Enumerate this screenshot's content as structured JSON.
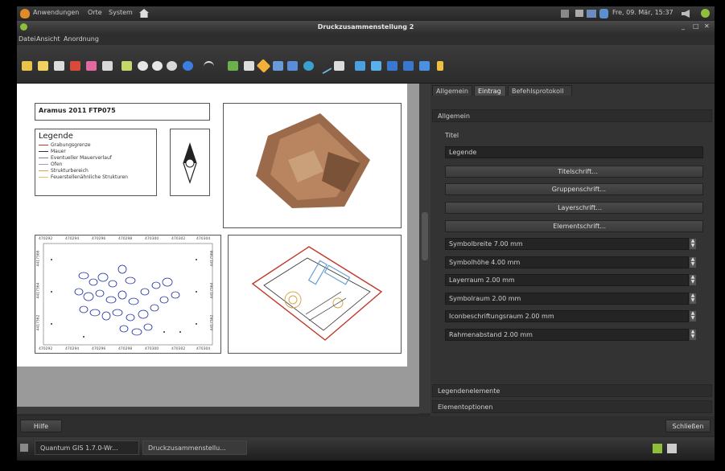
{
  "topbar": {
    "menus": [
      "Anwendungen",
      "Orte",
      "System"
    ],
    "clock": "Fre, 09. Mär, 15:37"
  },
  "window": {
    "title": "Druckzusammenstellung 2",
    "controls": [
      "_",
      "□",
      "✕"
    ]
  },
  "menubar": [
    "Datei",
    "Ansicht",
    "Anordnung"
  ],
  "composition": {
    "title_label": "Aramus 2011 FTP075",
    "legend_title": "Legende",
    "legend_items": [
      {
        "label": "Grabungsgrenze",
        "color": "#c0392b"
      },
      {
        "label": "Mauer",
        "color": "#333333"
      },
      {
        "label": "Eventueller Mauerverlauf",
        "color": "#7a7a9a"
      },
      {
        "label": "Ofen",
        "color": "#9999cc"
      },
      {
        "label": "Strukturbereich",
        "color": "#d4a64a"
      },
      {
        "label": "Feuerstellenähnliche Strukturen",
        "color": "#e0c060"
      }
    ],
    "grid_x_labels": [
      "470292",
      "470294",
      "470296",
      "470298",
      "470300",
      "470302",
      "470304"
    ],
    "grid_y_labels": [
      "4417366",
      "4417364",
      "4417362"
    ]
  },
  "panel": {
    "tabs": [
      "Allgemein",
      "Eintrag",
      "Befehlsprotokoll"
    ],
    "active_tab": "Eintrag",
    "section_general": "Allgemein",
    "title_label": "Titel",
    "title_value": "Legende",
    "font_buttons": [
      "Titelschrift...",
      "Gruppenschrift...",
      "Layerschrift...",
      "Elementschrift..."
    ],
    "spin_fields": [
      "Symbolbreite 7.00 mm",
      "Symbolhöhe 4.00 mm",
      "Layerraum 2.00 mm",
      "Symbolraum 2.00 mm",
      "Iconbeschriftungsraum 2.00 mm",
      "Rahmenabstand 2.00 mm"
    ],
    "section_legend_items": "Legendenelemente",
    "section_item_options": "Elementoptionen"
  },
  "bottom": {
    "help": "Hilfe",
    "close": "Schließen"
  },
  "taskbar": {
    "tasks": [
      "Quantum GIS 1.7.0-Wr...",
      "Druckzusammenstellu..."
    ]
  }
}
